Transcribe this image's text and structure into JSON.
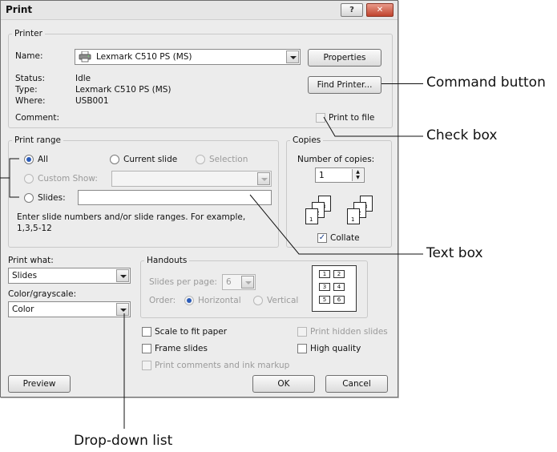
{
  "dialog": {
    "title": "Print",
    "help_button": "?",
    "close_button": "✕"
  },
  "printer": {
    "group_label": "Printer",
    "name_label": "Name:",
    "name_value": "Lexmark C510 PS (MS)",
    "properties_button": "Properties",
    "status_label": "Status:",
    "status_value": "Idle",
    "type_label": "Type:",
    "type_value": "Lexmark C510 PS (MS)",
    "where_label": "Where:",
    "where_value": "USB001",
    "comment_label": "Comment:",
    "find_printer_button": "Find Printer...",
    "print_to_file_label": "Print to file"
  },
  "print_range": {
    "group_label": "Print range",
    "all_label": "All",
    "current_slide_label": "Current slide",
    "selection_label": "Selection",
    "custom_show_label": "Custom Show:",
    "slides_label": "Slides:",
    "hint_line1": "Enter slide numbers and/or slide ranges. For example,",
    "hint_line2": "1,3,5-12"
  },
  "copies": {
    "group_label": "Copies",
    "number_label": "Number of copies:",
    "number_value": "1",
    "collate_label": "Collate",
    "page_numbers": [
      "1",
      "2",
      "3",
      "1",
      "2",
      "3"
    ]
  },
  "print_what": {
    "label": "Print what:",
    "value": "Slides",
    "color_label": "Color/grayscale:",
    "color_value": "Color"
  },
  "handouts": {
    "group_label": "Handouts",
    "slides_per_page_label": "Slides per page:",
    "slides_per_page_value": "6",
    "order_label": "Order:",
    "horizontal_label": "Horizontal",
    "vertical_label": "Vertical",
    "preview_numbers": [
      "1",
      "2",
      "3",
      "4",
      "5",
      "6"
    ]
  },
  "options": {
    "scale_to_fit": "Scale to fit paper",
    "frame_slides": "Frame slides",
    "print_comments": "Print comments and ink markup",
    "print_hidden": "Print hidden slides",
    "high_quality": "High quality"
  },
  "footer": {
    "preview_button": "Preview",
    "ok_button": "OK",
    "cancel_button": "Cancel"
  },
  "annotations": {
    "command_button": "Command button",
    "check_box": "Check box",
    "text_box": "Text box",
    "drop_down_list": "Drop-down list"
  },
  "colors": {
    "accent": "#2a5bb8",
    "dialog_bg": "#ececec"
  },
  "icons": {
    "printer": "printer-icon",
    "check": "checkmark-icon"
  }
}
